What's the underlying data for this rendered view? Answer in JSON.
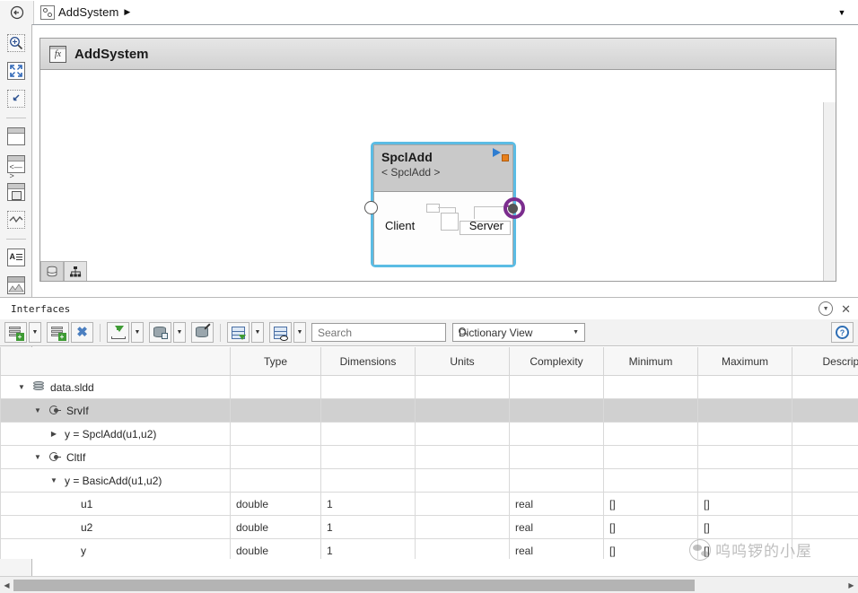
{
  "topbar": {
    "back_icon": "back-circle-icon",
    "crumb_icon": "model-block-icon",
    "crumb_label": "AddSystem",
    "crumb_arrow": "▶",
    "menu_icon": "chevron-down-icon"
  },
  "left_toolbar": {
    "items": [
      {
        "name": "zoom-tool",
        "glyph": "⊕"
      },
      {
        "name": "fit-to-view-tool",
        "glyph": "⤡"
      },
      {
        "name": "pan-select-tool",
        "glyph": "↖"
      },
      {
        "name": "subsystem-tool",
        "glyph": ""
      },
      {
        "name": "code-block-tool",
        "glyph": "<>"
      },
      {
        "name": "model-reference-tool",
        "glyph": ""
      },
      {
        "name": "state-chart-tool",
        "glyph": "∿"
      },
      {
        "name": "annotation-tool",
        "glyph": "A"
      },
      {
        "name": "image-tool",
        "glyph": "∿"
      },
      {
        "name": "area-tool",
        "glyph": ""
      }
    ]
  },
  "canvas": {
    "title": "AddSystem",
    "fx_icon": "fx-icon",
    "block": {
      "name": "SpclAdd",
      "subtitle": "< SpclAdd >",
      "client_port": "Client",
      "server_port": "Server",
      "selected_border_color": "#5bbce4",
      "header_color": "#c9c9c9",
      "output_port_color": "#7b2d8e",
      "badge_triangle_color": "#2e7dd1",
      "badge_square_color": "#e8801c"
    },
    "badges": [
      {
        "name": "data-layer-badge",
        "glyph": "≡"
      },
      {
        "name": "hierarchy-badge",
        "glyph": "⑂"
      }
    ]
  },
  "panel": {
    "title": "Interfaces",
    "collapse_icon": "collapse-circle-icon",
    "close_icon": "close-icon",
    "toolbar": {
      "buttons": [
        {
          "name": "add-interface-button",
          "icon": "add-stack-icon",
          "has_caret": true
        },
        {
          "name": "add-element-button",
          "icon": "add-stack-icon",
          "has_caret": false
        },
        {
          "name": "delete-button",
          "icon": "delete-x-icon",
          "has_caret": false
        },
        {
          "name": "import-button",
          "icon": "import-down-icon",
          "has_caret": true
        },
        {
          "name": "save-dictionary-button",
          "icon": "database-save-icon",
          "has_caret": true
        },
        {
          "name": "link-dictionary-button",
          "icon": "database-link-icon",
          "has_caret": false
        },
        {
          "name": "export-button",
          "icon": "export-grid-icon",
          "has_caret": true
        },
        {
          "name": "view-options-button",
          "icon": "grid-eye-icon",
          "has_caret": true
        }
      ],
      "search_placeholder": "Search",
      "search_value": "",
      "search_icon": "search-icon",
      "view_select_value": "Dictionary View",
      "view_select_caret": "chevron-down-icon",
      "help_label": "?"
    }
  },
  "table": {
    "columns": [
      "",
      "Type",
      "Dimensions",
      "Units",
      "Complexity",
      "Minimum",
      "Maximum",
      "Description"
    ],
    "rows": [
      {
        "name": "data.sldd",
        "indent": 0,
        "twisty": "▼",
        "icon": "dictionary-icon",
        "selected": false,
        "type": "",
        "dimensions": "",
        "units": "",
        "complexity": "",
        "minimum": "",
        "maximum": "",
        "description": ""
      },
      {
        "name": "SrvIf",
        "indent": 1,
        "twisty": "▼",
        "icon": "interface-icon",
        "selected": true,
        "type": "",
        "dimensions": "",
        "units": "",
        "complexity": "",
        "minimum": "",
        "maximum": "",
        "description": ""
      },
      {
        "name": "y = SpclAdd(u1,u2)",
        "indent": 2,
        "twisty": "▶",
        "icon": "",
        "selected": false,
        "type": "",
        "dimensions": "",
        "units": "",
        "complexity": "",
        "minimum": "",
        "maximum": "",
        "description": ""
      },
      {
        "name": "CltIf",
        "indent": 1,
        "twisty": "▼",
        "icon": "interface-icon",
        "selected": false,
        "type": "",
        "dimensions": "",
        "units": "",
        "complexity": "",
        "minimum": "",
        "maximum": "",
        "description": ""
      },
      {
        "name": "y = BasicAdd(u1,u2)",
        "indent": 2,
        "twisty": "▼",
        "icon": "",
        "selected": false,
        "type": "",
        "dimensions": "",
        "units": "",
        "complexity": "",
        "minimum": "",
        "maximum": "",
        "description": ""
      },
      {
        "name": "u1",
        "indent": 3,
        "twisty": "",
        "icon": "",
        "selected": false,
        "type": "double",
        "dimensions": "1",
        "units": "",
        "complexity": "real",
        "minimum": "[]",
        "maximum": "[]",
        "description": ""
      },
      {
        "name": "u2",
        "indent": 3,
        "twisty": "",
        "icon": "",
        "selected": false,
        "type": "double",
        "dimensions": "1",
        "units": "",
        "complexity": "real",
        "minimum": "[]",
        "maximum": "[]",
        "description": ""
      },
      {
        "name": "y",
        "indent": 3,
        "twisty": "",
        "icon": "",
        "selected": false,
        "type": "double",
        "dimensions": "1",
        "units": "",
        "complexity": "real",
        "minimum": "[]",
        "maximum": "[]",
        "description": ""
      }
    ]
  },
  "scrollbar": {
    "left_arrow": "◀",
    "right_arrow": "▶"
  },
  "watermark": {
    "logo": "wechat-logo-icon",
    "text": "呜呜锣的小屋"
  }
}
